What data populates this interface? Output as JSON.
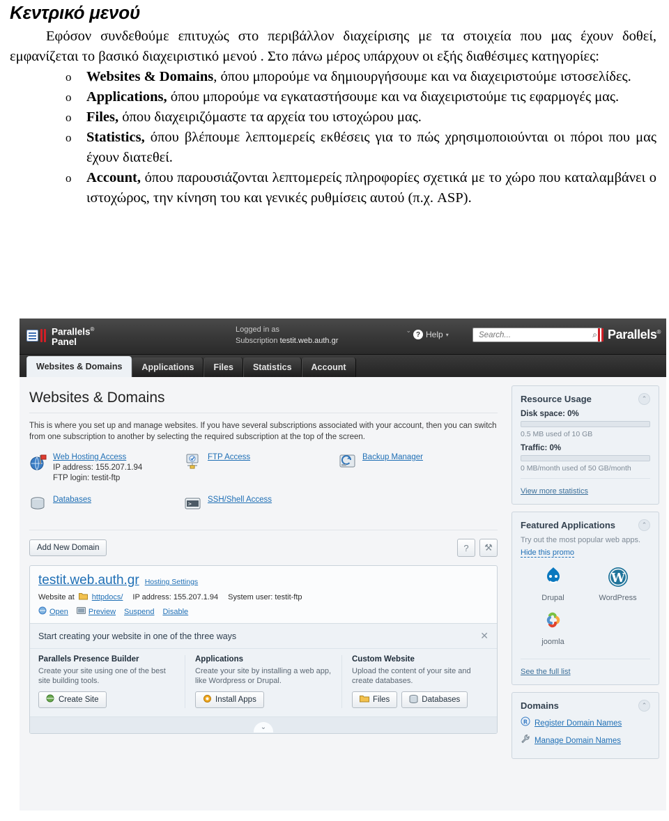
{
  "document": {
    "heading": "Κεντρικό μενού",
    "intro": "Εφόσον συνδεθούμε επιτυχώς στο περιβάλλον διαχείρισης με τα στοιχεία που μας έχουν δοθεί, εμφανίζεται το βασικό διαχειριστικό μενού . Στο πάνω μέρος υπάρχουν οι εξής διαθέσιμες κατηγορίες:",
    "bullet_marker": "o",
    "items": [
      {
        "term": "Websites & Domains",
        "rest": ", όπου μπορούμε να δημιουργήσουμε και να διαχειριστούμε ιστοσελίδες."
      },
      {
        "term": "Applications,",
        "rest": " όπου μπορούμε να εγκαταστήσουμε και να διαχειριστούμε τις εφαρμογές μας."
      },
      {
        "term": "Files,",
        "rest": " όπου διαχειριζόμαστε τα αρχεία του ιστοχώρου μας."
      },
      {
        "term": "Statistics,",
        "rest": " όπου βλέπουμε λεπτομερείς εκθέσεις για το πώς χρησιμοποιούνται οι πόροι που μας έχουν διατεθεί."
      },
      {
        "term": "Account,",
        "rest": " όπου παρουσιάζονται λεπτομερείς πληροφορίες σχετικά με το χώρο που καταλαμβάνει ο ιστοχώρος, την κίνηση του και γενικές ρυθμίσεις αυτού (π.χ. ASP)."
      }
    ]
  },
  "panel": {
    "logo": {
      "line1": "Parallels",
      "line2": "Panel",
      "reg": "®"
    },
    "brand": {
      "text": "Parallels",
      "reg": "®"
    },
    "login": {
      "label": "Logged in as",
      "subscription_label": "Subscription",
      "subscription_value": "testit.web.auth.gr",
      "caret": "⌄"
    },
    "help": {
      "label": "Help",
      "glyph": "?",
      "caret": "▾"
    },
    "search": {
      "placeholder": "Search...",
      "value": "",
      "icon": "⌕"
    },
    "tabs": [
      {
        "label": "Websites & Domains",
        "active": true
      },
      {
        "label": "Applications",
        "active": false
      },
      {
        "label": "Files",
        "active": false
      },
      {
        "label": "Statistics",
        "active": false
      },
      {
        "label": "Account",
        "active": false
      }
    ],
    "main": {
      "title": "Websites & Domains",
      "intro": "This is where you set up and manage websites. If you have several subscriptions associated with your account, then you can switch from one subscription to another by selecting the required subscription at the top of the screen.",
      "tools": [
        {
          "icon": "web-hosting-access-icon",
          "link": "Web Hosting Access",
          "line2": "IP address: 155.207.1.94",
          "line3": "FTP login: testit-ftp"
        },
        {
          "icon": "ftp-access-icon",
          "link": "FTP Access",
          "line2": "",
          "line3": ""
        },
        {
          "icon": "backup-manager-icon",
          "link": "Backup Manager",
          "line2": "",
          "line3": ""
        },
        {
          "icon": "databases-icon",
          "link": "Databases",
          "line2": "",
          "line3": ""
        },
        {
          "icon": "ssh-shell-access-icon",
          "link": "SSH/Shell Access",
          "line2": "",
          "line3": ""
        }
      ],
      "add_domain_button": "Add New Domain",
      "help_button": "?",
      "settings_button": "⚒",
      "domain_card": {
        "name": "testit.web.auth.gr",
        "hosting_settings": "Hosting Settings",
        "website_at_label": "Website at",
        "httpdocs": "httpdocs/",
        "ip_address": "IP address: 155.207.1.94",
        "system_user": "System user: testit-ftp",
        "actions": [
          "Open",
          "Preview",
          "Suspend",
          "Disable"
        ]
      },
      "promo": {
        "title": "Start creating your website in one of the three ways",
        "close": "✕",
        "columns": [
          {
            "heading": "Parallels Presence Builder",
            "text": "Create your site using one of the best site building tools.",
            "buttons": [
              "Create Site"
            ]
          },
          {
            "heading": "Applications",
            "text": "Create your site by installing a web app, like Wordpress or Drupal.",
            "buttons": [
              "Install Apps"
            ]
          },
          {
            "heading": "Custom Website",
            "text": "Upload the content of your site and create databases.",
            "buttons": [
              "Files",
              "Databases"
            ]
          }
        ],
        "expand_chevron": "⌄"
      }
    },
    "sidebar": {
      "resource_usage": {
        "title": "Resource Usage",
        "collapse": "⌃",
        "disk_label": "Disk space: 0%",
        "disk_note": "0.5 MB used of 10 GB",
        "disk_percent": 0,
        "traffic_label": "Traffic: 0%",
        "traffic_note": "0 MB/month used of 50 GB/month",
        "traffic_percent": 0,
        "link": "View more statistics"
      },
      "featured_applications": {
        "title": "Featured Applications",
        "collapse": "⌃",
        "subtitle": "Try out the most popular web apps.",
        "hide_promo": "Hide this promo",
        "apps": [
          {
            "name": "Drupal",
            "icon": "drupal-icon"
          },
          {
            "name": "WordPress",
            "icon": "wordpress-icon"
          },
          {
            "name": "joomla",
            "icon": "joomla-icon"
          }
        ],
        "link": "See the full list"
      },
      "domains": {
        "title": "Domains",
        "collapse": "⌃",
        "links": [
          {
            "label": "Register Domain Names",
            "icon": "register-icon"
          },
          {
            "label": "Manage Domain Names",
            "icon": "wrench-icon"
          }
        ]
      }
    }
  },
  "colors": {
    "accent_link": "#1f6fb5",
    "brand_red": "#d01f26",
    "header_dark": "#3a3a3a",
    "panel_bg": "#eef2f6"
  }
}
